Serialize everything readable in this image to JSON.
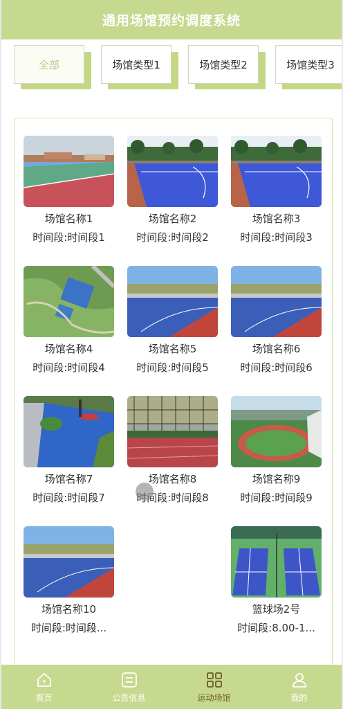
{
  "app": {
    "title": "通用场馆预约调度系统"
  },
  "tabs": [
    {
      "label": "全部"
    },
    {
      "label": "场馆类型1"
    },
    {
      "label": "场馆类型2"
    },
    {
      "label": "场馆类型3"
    }
  ],
  "venues": [
    {
      "name": "场馆名称1",
      "time": "时间段:时间段1",
      "image": "basketball-court-red-green"
    },
    {
      "name": "场馆名称2",
      "time": "时间段:时间段2",
      "image": "blue-court-trees"
    },
    {
      "name": "场馆名称3",
      "time": "时间段:时间段3",
      "image": "blue-court-trees"
    },
    {
      "name": "场馆名称4",
      "time": "时间段:时间段4",
      "image": "aerial-park-court"
    },
    {
      "name": "场馆名称5",
      "time": "时间段:时间段5",
      "image": "blue-red-court-sky"
    },
    {
      "name": "场馆名称6",
      "time": "时间段:时间段6",
      "image": "blue-red-court-sky"
    },
    {
      "name": "场馆名称7",
      "time": "时间段:时间段7",
      "image": "blue-path-garden"
    },
    {
      "name": "场馆名称8",
      "time": "时间段:时间段8",
      "image": "red-track-fence"
    },
    {
      "name": "场馆名称9",
      "time": "时间段:时间段9",
      "image": "stadium-aerial"
    },
    {
      "name": "场馆名称10",
      "time": "时间段:时间段...",
      "image": "blue-red-court-sky"
    },
    {
      "name": "",
      "time": "",
      "image": ""
    },
    {
      "name": "篮球场2号",
      "time": "时间段:8.00-1...",
      "image": "tennis-courts-green"
    }
  ],
  "nav": [
    {
      "label": "首页",
      "icon": "home-icon"
    },
    {
      "label": "公告信息",
      "icon": "notice-icon"
    },
    {
      "label": "运动场馆",
      "icon": "grid-icon",
      "active": true
    },
    {
      "label": "我的",
      "icon": "user-icon"
    }
  ],
  "colors": {
    "accent": "#c7d98f",
    "tab_shadow": "#c4d884",
    "active_nav": "#6b5a2a"
  }
}
